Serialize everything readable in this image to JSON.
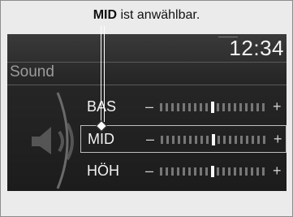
{
  "caption": {
    "bold": "MID",
    "rest": " ist anwählbar."
  },
  "screen": {
    "clock": "12:34",
    "title": "Sound"
  },
  "icons": {
    "speaker": "speaker-icon"
  },
  "rows": [
    {
      "label": "BAS",
      "level": 0.5,
      "selected": false,
      "minus": "–",
      "plus": "+"
    },
    {
      "label": "MID",
      "level": 0.5,
      "selected": true,
      "minus": "–",
      "plus": "+"
    },
    {
      "label": "HÖH",
      "level": 0.5,
      "selected": false,
      "minus": "–",
      "plus": "+"
    }
  ]
}
